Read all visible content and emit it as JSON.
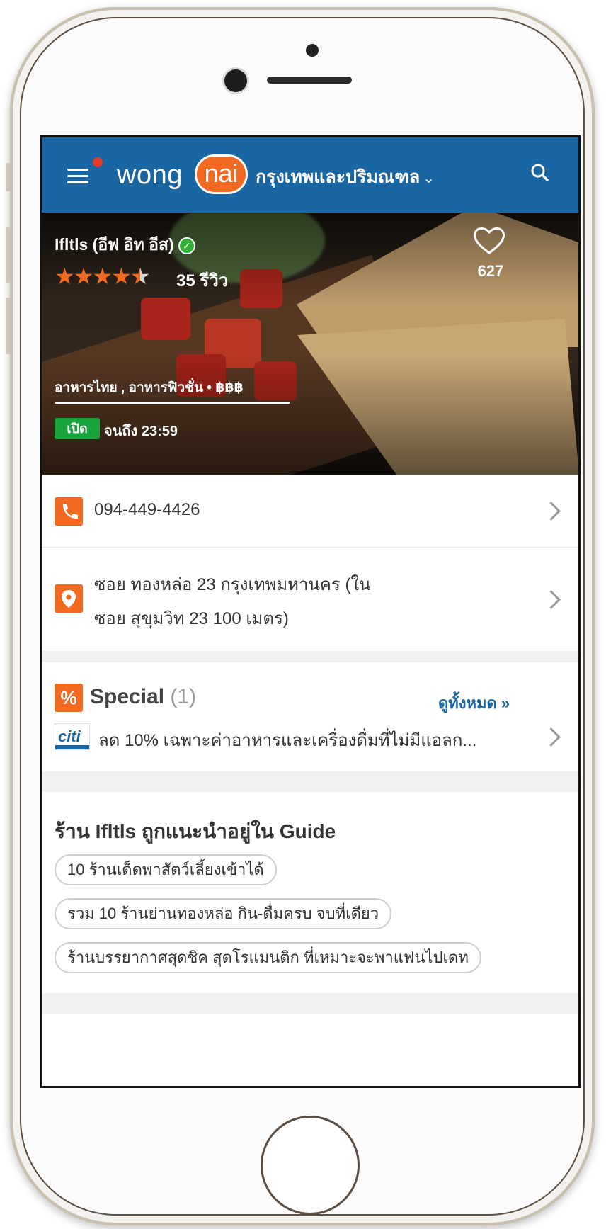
{
  "header": {
    "logo_text": "wong",
    "logo_badge": "nai",
    "city": "กรุงเทพและปริมณฑล",
    "city_chevron": "⌄",
    "icons": {
      "menu": "hamburger-menu-icon",
      "search": "search-icon"
    }
  },
  "restaurant": {
    "name": "Ifltls (อีฟ อิท อีส)",
    "verified_glyph": "✓",
    "rating": 4.5,
    "rating_max": 5,
    "reviews_label": "35 รีวิว",
    "favorites": "627",
    "cuisine": "อาหารไทย , อาหารฟิวชั่น  •  ฿฿฿",
    "open_badge": "เปิด",
    "open_until": "จนถึง 23:59"
  },
  "contact": {
    "phone": "094-449-4426",
    "address_line1": "ซอย ทองหล่อ 23 กรุงเทพมหานคร (ใน",
    "address_line2": "ซอย สุขุมวิท 23 100 เมตร)"
  },
  "special": {
    "icon_glyph": "%",
    "title": "Special",
    "count": "(1)",
    "see_all": "ดูทั้งหมด »",
    "bank_logo": "citi",
    "deal_text": "ลด 10% เฉพาะค่าอาหารและเครื่องดื่มที่ไม่มีแอลก..."
  },
  "guide": {
    "title": "ร้าน Ifltls ถูกแนะนำอยู่ใน Guide",
    "chips": [
      "10 ร้านเด็ดพาสัตว์เลี้ยงเข้าได้",
      "รวม 10 ร้านย่านทองหล่อ กิน-ดื่มครบ จบที่เดียว",
      "ร้านบรรยากาศสุดชิค สุดโรแมนติก ที่เหมาะจะพาแฟนไปเดท"
    ]
  },
  "colors": {
    "brand_blue": "#1a66a3",
    "brand_orange": "#f26a21",
    "open_green": "#18a33b"
  }
}
